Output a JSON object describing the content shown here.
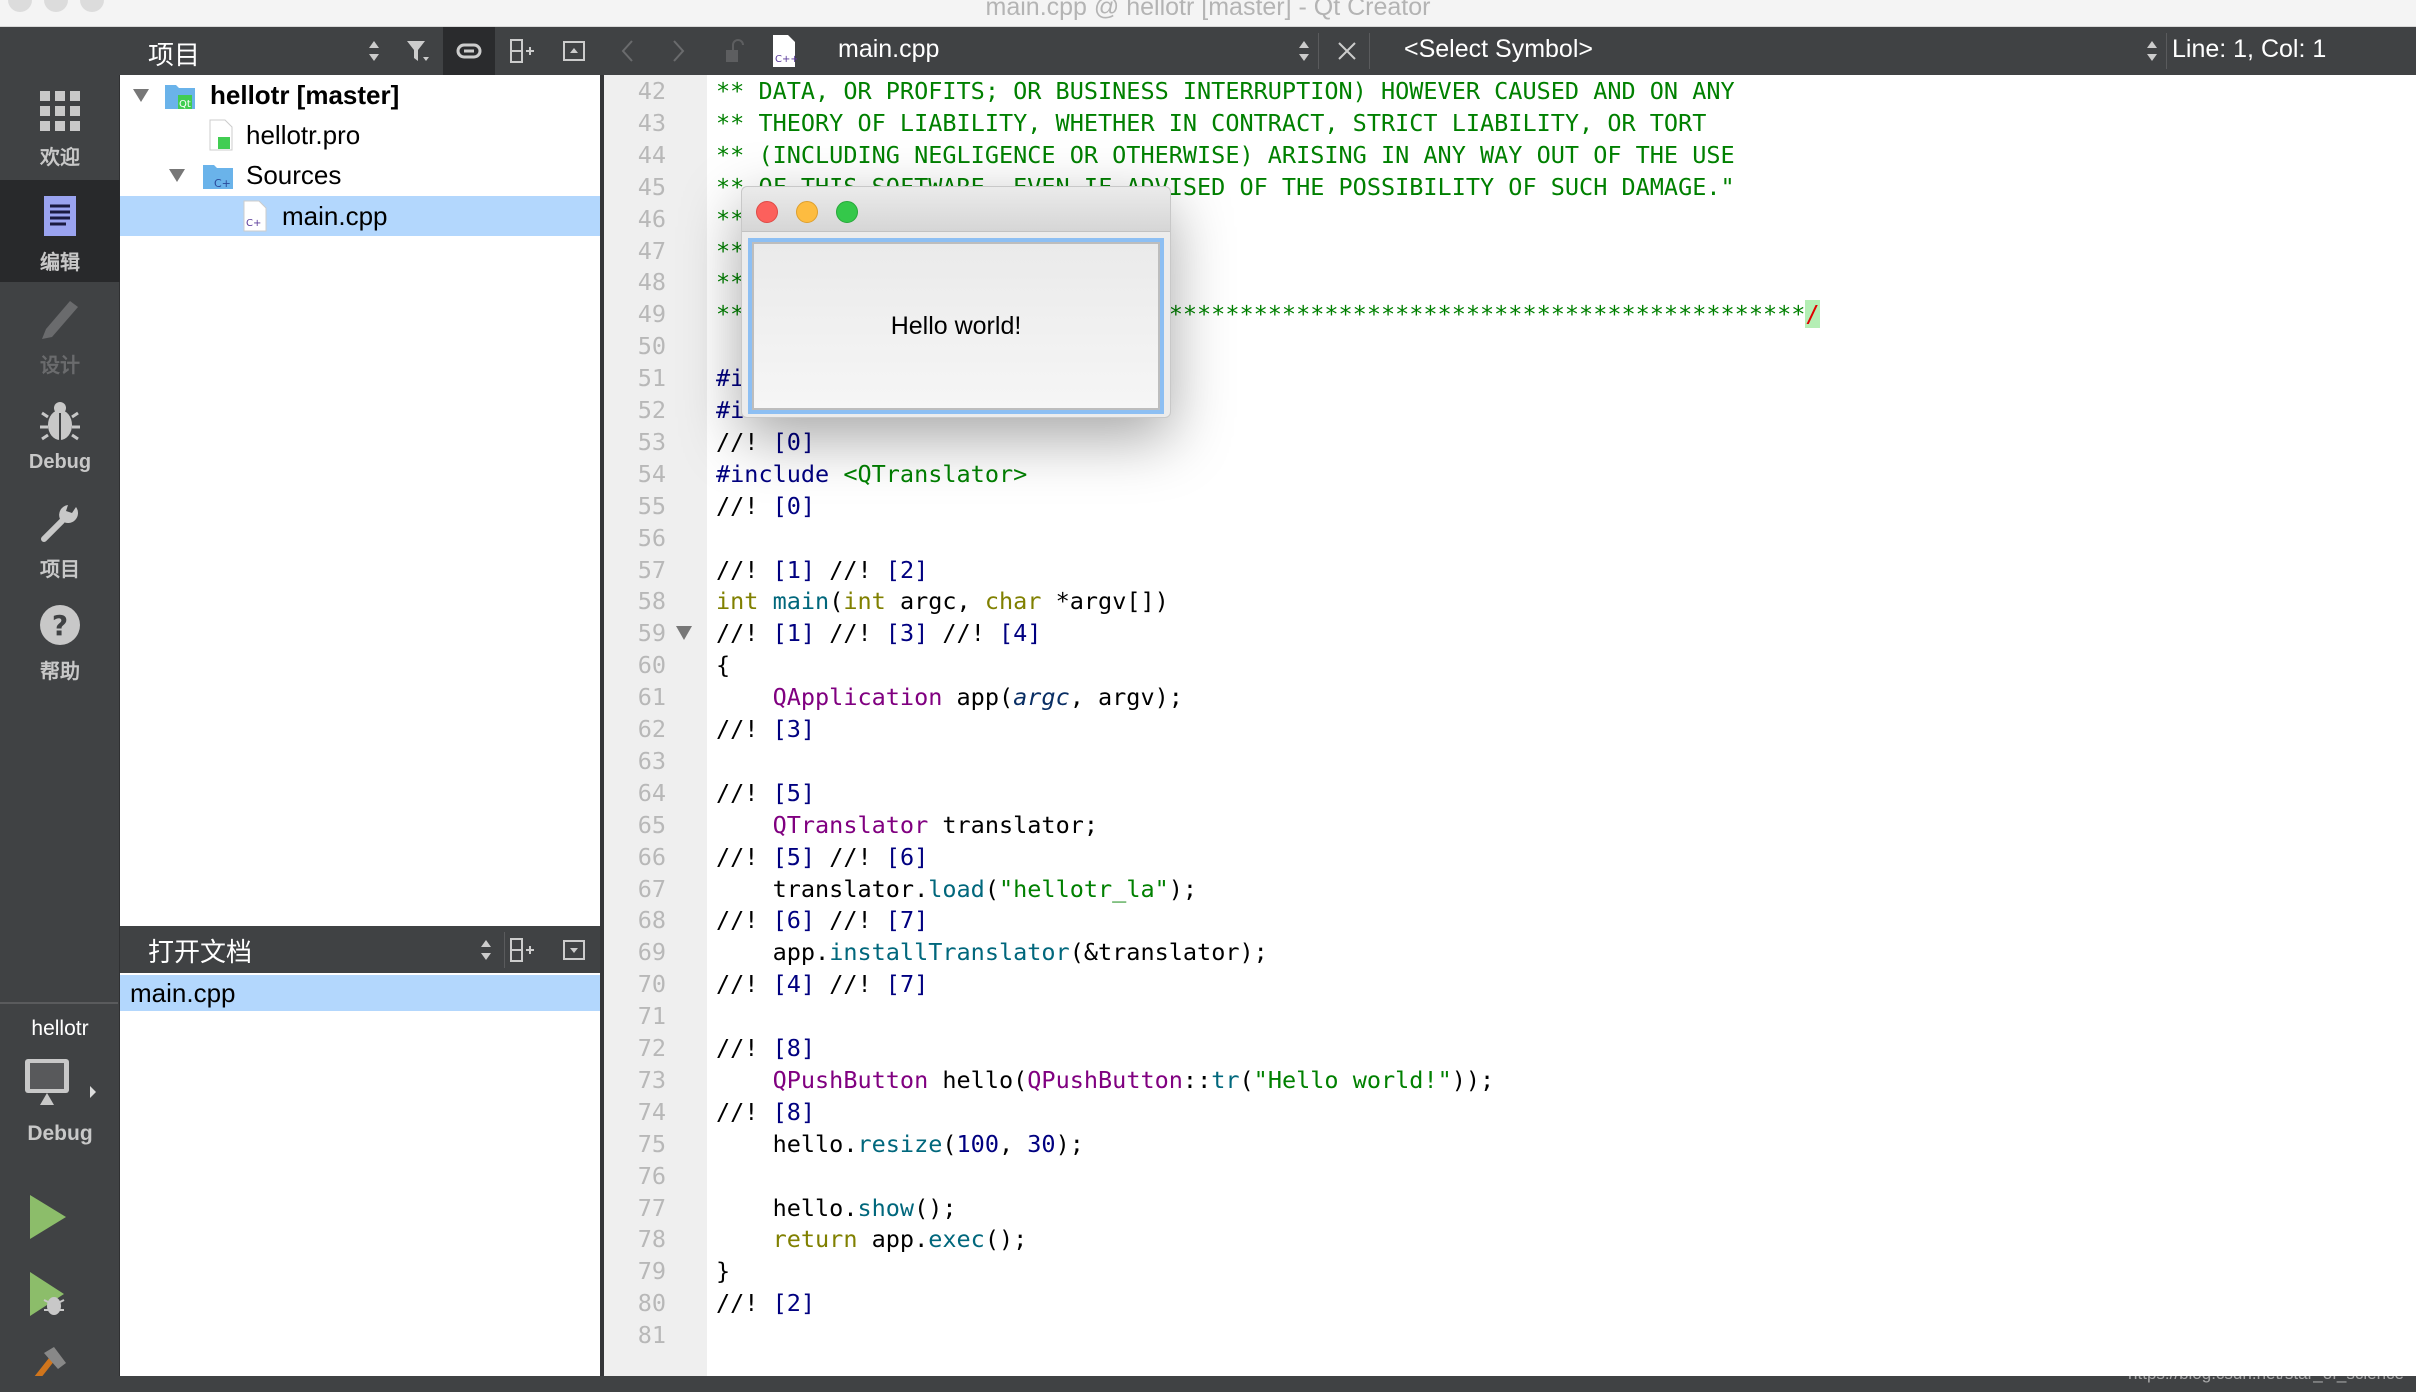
{
  "window": {
    "title": "main.cpp @ hellotr [master] - Qt Creator"
  },
  "modes": [
    {
      "label": "欢迎",
      "icon": "grid-icon",
      "selected": false
    },
    {
      "label": "编辑",
      "icon": "edit-document-icon",
      "selected": true
    },
    {
      "label": "设计",
      "icon": "pencil-icon",
      "selected": false,
      "disabled": true
    },
    {
      "label": "Debug",
      "icon": "bug-icon",
      "selected": false
    },
    {
      "label": "项目",
      "icon": "wrench-icon",
      "selected": false
    },
    {
      "label": "帮助",
      "icon": "help-icon",
      "selected": false
    }
  ],
  "kit": {
    "project": "hellotr",
    "build": "Debug"
  },
  "projects_panel": {
    "title": "项目",
    "tree": [
      {
        "label": "hellotr [master]",
        "level": 0,
        "expanded": true,
        "icon": "qt-project-folder-icon",
        "bold": true
      },
      {
        "label": "hellotr.pro",
        "level": 1,
        "icon": "qt-pro-file-icon"
      },
      {
        "label": "Sources",
        "level": 1,
        "expanded": true,
        "icon": "cpp-folder-icon"
      },
      {
        "label": "main.cpp",
        "level": 2,
        "icon": "cpp-file-icon",
        "selected": true
      }
    ]
  },
  "open_docs": {
    "title": "打开文档",
    "items": [
      {
        "label": "main.cpp",
        "selected": true
      }
    ]
  },
  "editor": {
    "file": "main.cpp",
    "symbol": "<Select Symbol>",
    "position": "Line: 1, Col: 1",
    "first_line": 42,
    "fold_line": 59,
    "lines": [
      [
        [
          "** DATA, OR PROFITS; OR BUSINESS INTERRUPTION) HOWEVER CAUSED AND ON ANY",
          "c"
        ]
      ],
      [
        [
          "** THEORY OF LIABILITY, WHETHER IN CONTRACT, STRICT LIABILITY, OR TORT",
          "c"
        ]
      ],
      [
        [
          "** (INCLUDING NEGLIGENCE OR OTHERWISE) ARISING IN ANY WAY OUT OF THE USE",
          "c"
        ]
      ],
      [
        [
          "** OF THIS SOFTWARE, EVEN IF ADVISED OF THE POSSIBILITY OF SUCH DAMAGE.\"",
          "c"
        ]
      ],
      [
        [
          "**",
          "c"
        ]
      ],
      [
        [
          "**",
          "c"
        ]
      ],
      [
        [
          "**",
          "c"
        ]
      ],
      [
        [
          "*****************************************************************************",
          "c"
        ],
        [
          "/",
          "e"
        ]
      ],
      [],
      [
        [
          "#i",
          "n"
        ]
      ],
      [
        [
          "#i",
          "n"
        ]
      ],
      [
        [
          "//! ",
          "d"
        ],
        [
          "[0]",
          "n"
        ]
      ],
      [
        [
          "#include ",
          "n"
        ],
        [
          "<QTranslator>",
          "s"
        ]
      ],
      [
        [
          "//! ",
          "d"
        ],
        [
          "[0]",
          "n"
        ]
      ],
      [],
      [
        [
          "//! ",
          "d"
        ],
        [
          "[1]",
          "n"
        ],
        [
          " //! ",
          "d"
        ],
        [
          "[2]",
          "n"
        ]
      ],
      [
        [
          "int",
          "k"
        ],
        [
          " ",
          "d"
        ],
        [
          "main",
          "f"
        ],
        [
          "(",
          "d"
        ],
        [
          "int",
          "k"
        ],
        [
          " argc, ",
          "d"
        ],
        [
          "char",
          "k"
        ],
        [
          " *argv[])",
          "d"
        ]
      ],
      [
        [
          "//! ",
          "d"
        ],
        [
          "[1]",
          "n"
        ],
        [
          " //! ",
          "d"
        ],
        [
          "[3]",
          "n"
        ],
        [
          " //! ",
          "d"
        ],
        [
          "[4]",
          "n"
        ]
      ],
      [
        [
          "{",
          "d"
        ]
      ],
      [
        [
          "    ",
          "d"
        ],
        [
          "QApplication",
          "t"
        ],
        [
          " app(",
          "d"
        ],
        [
          "argc",
          "i"
        ],
        [
          ", argv);",
          "d"
        ]
      ],
      [
        [
          "//! ",
          "d"
        ],
        [
          "[3]",
          "n"
        ]
      ],
      [],
      [
        [
          "//! ",
          "d"
        ],
        [
          "[5]",
          "n"
        ]
      ],
      [
        [
          "    ",
          "d"
        ],
        [
          "QTranslator",
          "t"
        ],
        [
          " translator;",
          "d"
        ]
      ],
      [
        [
          "//! ",
          "d"
        ],
        [
          "[5]",
          "n"
        ],
        [
          " //! ",
          "d"
        ],
        [
          "[6]",
          "n"
        ]
      ],
      [
        [
          "    translator.",
          "d"
        ],
        [
          "load",
          "f"
        ],
        [
          "(",
          "d"
        ],
        [
          "\"hellotr_la\"",
          "s"
        ],
        [
          ");",
          "d"
        ]
      ],
      [
        [
          "//! ",
          "d"
        ],
        [
          "[6]",
          "n"
        ],
        [
          " //! ",
          "d"
        ],
        [
          "[7]",
          "n"
        ]
      ],
      [
        [
          "    app.",
          "d"
        ],
        [
          "installTranslator",
          "f"
        ],
        [
          "(&translator);",
          "d"
        ]
      ],
      [
        [
          "//! ",
          "d"
        ],
        [
          "[4]",
          "n"
        ],
        [
          " //! ",
          "d"
        ],
        [
          "[7]",
          "n"
        ]
      ],
      [],
      [
        [
          "//! ",
          "d"
        ],
        [
          "[8]",
          "n"
        ]
      ],
      [
        [
          "    ",
          "d"
        ],
        [
          "QPushButton",
          "t"
        ],
        [
          " hello(",
          "d"
        ],
        [
          "QPushButton",
          "t"
        ],
        [
          "::",
          "d"
        ],
        [
          "tr",
          "f"
        ],
        [
          "(",
          "d"
        ],
        [
          "\"Hello world!\"",
          "s"
        ],
        [
          "));",
          "d"
        ]
      ],
      [
        [
          "//! ",
          "d"
        ],
        [
          "[8]",
          "n"
        ]
      ],
      [
        [
          "    hello.",
          "d"
        ],
        [
          "resize",
          "f"
        ],
        [
          "(",
          "d"
        ],
        [
          "100",
          "n"
        ],
        [
          ", ",
          "d"
        ],
        [
          "30",
          "n"
        ],
        [
          ");",
          "d"
        ]
      ],
      [],
      [
        [
          "    hello.",
          "d"
        ],
        [
          "show",
          "f"
        ],
        [
          "();",
          "d"
        ]
      ],
      [
        [
          "    ",
          "d"
        ],
        [
          "return",
          "k"
        ],
        [
          " app.",
          "d"
        ],
        [
          "exec",
          "f"
        ],
        [
          "();",
          "d"
        ]
      ],
      [
        [
          "}",
          "d"
        ]
      ],
      [
        [
          "//! ",
          "d"
        ],
        [
          "[2]",
          "n"
        ]
      ],
      []
    ]
  },
  "dialog": {
    "button_label": "Hello world!"
  },
  "watermark": "https://blog.csdn.net/star_of_science",
  "colors": {
    "sidebar": "#404244",
    "selection": "#b3d7fd",
    "comment": "#008000",
    "type": "#800080",
    "keyword": "#808000",
    "function": "#00677c",
    "number": "#000080"
  }
}
